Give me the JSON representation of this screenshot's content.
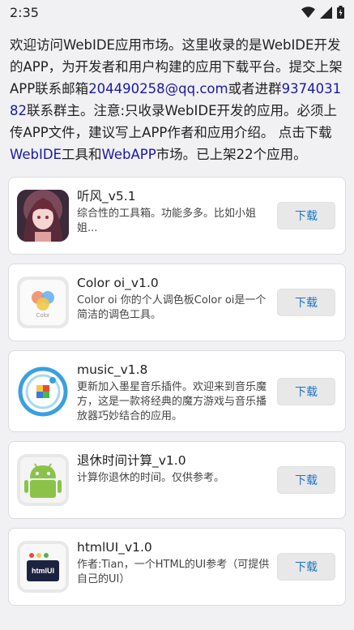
{
  "status_bar": {
    "time": "2:35"
  },
  "intro": {
    "part1": "欢迎访问WebIDE应用市场。这里收录的是WebIDE开发的APP，为开发者和用户构建的应用下载平台。提交上架APP联系邮箱",
    "email": "204490258@qq.com",
    "part2": "或者进群",
    "group": "937403182",
    "part3": "联系群主。注意:只收录WebIDE开发的应用。必须上传APP文件，建议写上APP作者和应用介绍。 点击下载",
    "link1": "WebIDE",
    "part4": "工具和",
    "link2": "WebAPP",
    "part5": "市场。已上架22个应用。"
  },
  "apps": [
    {
      "name": "听风_v5.1",
      "desc": "综合性的工具箱。功能多多。比如小姐姐...",
      "button": "下载",
      "icon": "anime-girl-icon"
    },
    {
      "name": "Color oi_v1.0",
      "desc": "Color oi 你的个人调色板Color oi是一个简洁的调色工具。",
      "button": "下载",
      "icon": "color-palette-icon",
      "icon_label": "Color"
    },
    {
      "name": "music_v1.8",
      "desc": "更新加入墨星音乐插件。欢迎来到音乐魔方，这是一款将经典的魔方游戏与音乐播放器巧妙结合的应用。",
      "button": "下载",
      "icon": "music-cube-icon"
    },
    {
      "name": "退休时间计算_v1.0",
      "desc": "计算你退休的时间。仅供参考。",
      "button": "下载",
      "icon": "android-icon"
    },
    {
      "name": "htmlUI_v1.0",
      "desc": "作者:Tian，一个HTML的UI参考（可提供自己的UI）",
      "button": "下载",
      "icon": "htmlui-icon",
      "icon_label": "htmlUI"
    }
  ]
}
